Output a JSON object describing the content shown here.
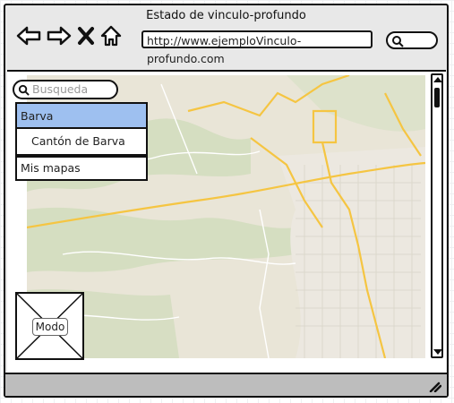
{
  "window": {
    "title": "Estado de vinculo-profundo"
  },
  "toolbar": {
    "back_icon": "arrow-left-icon",
    "forward_icon": "arrow-right-icon",
    "stop_icon": "x-icon",
    "home_icon": "home-icon",
    "url": "http://www.ejemploVinculo-profundo.com",
    "search_icon": "search-icon"
  },
  "map": {
    "search_placeholder": "Busqueda",
    "results": [
      {
        "label": "Barva",
        "selected": true
      },
      {
        "label": "Cantón de Barva",
        "selected": false
      }
    ],
    "my_maps": "Mis mapas",
    "mode_label": "Modo"
  },
  "colors": {
    "selected": "#9ec0f0",
    "map_base": "#e9e5d7",
    "road": "#f5c542",
    "green": "#c9d9b5"
  }
}
